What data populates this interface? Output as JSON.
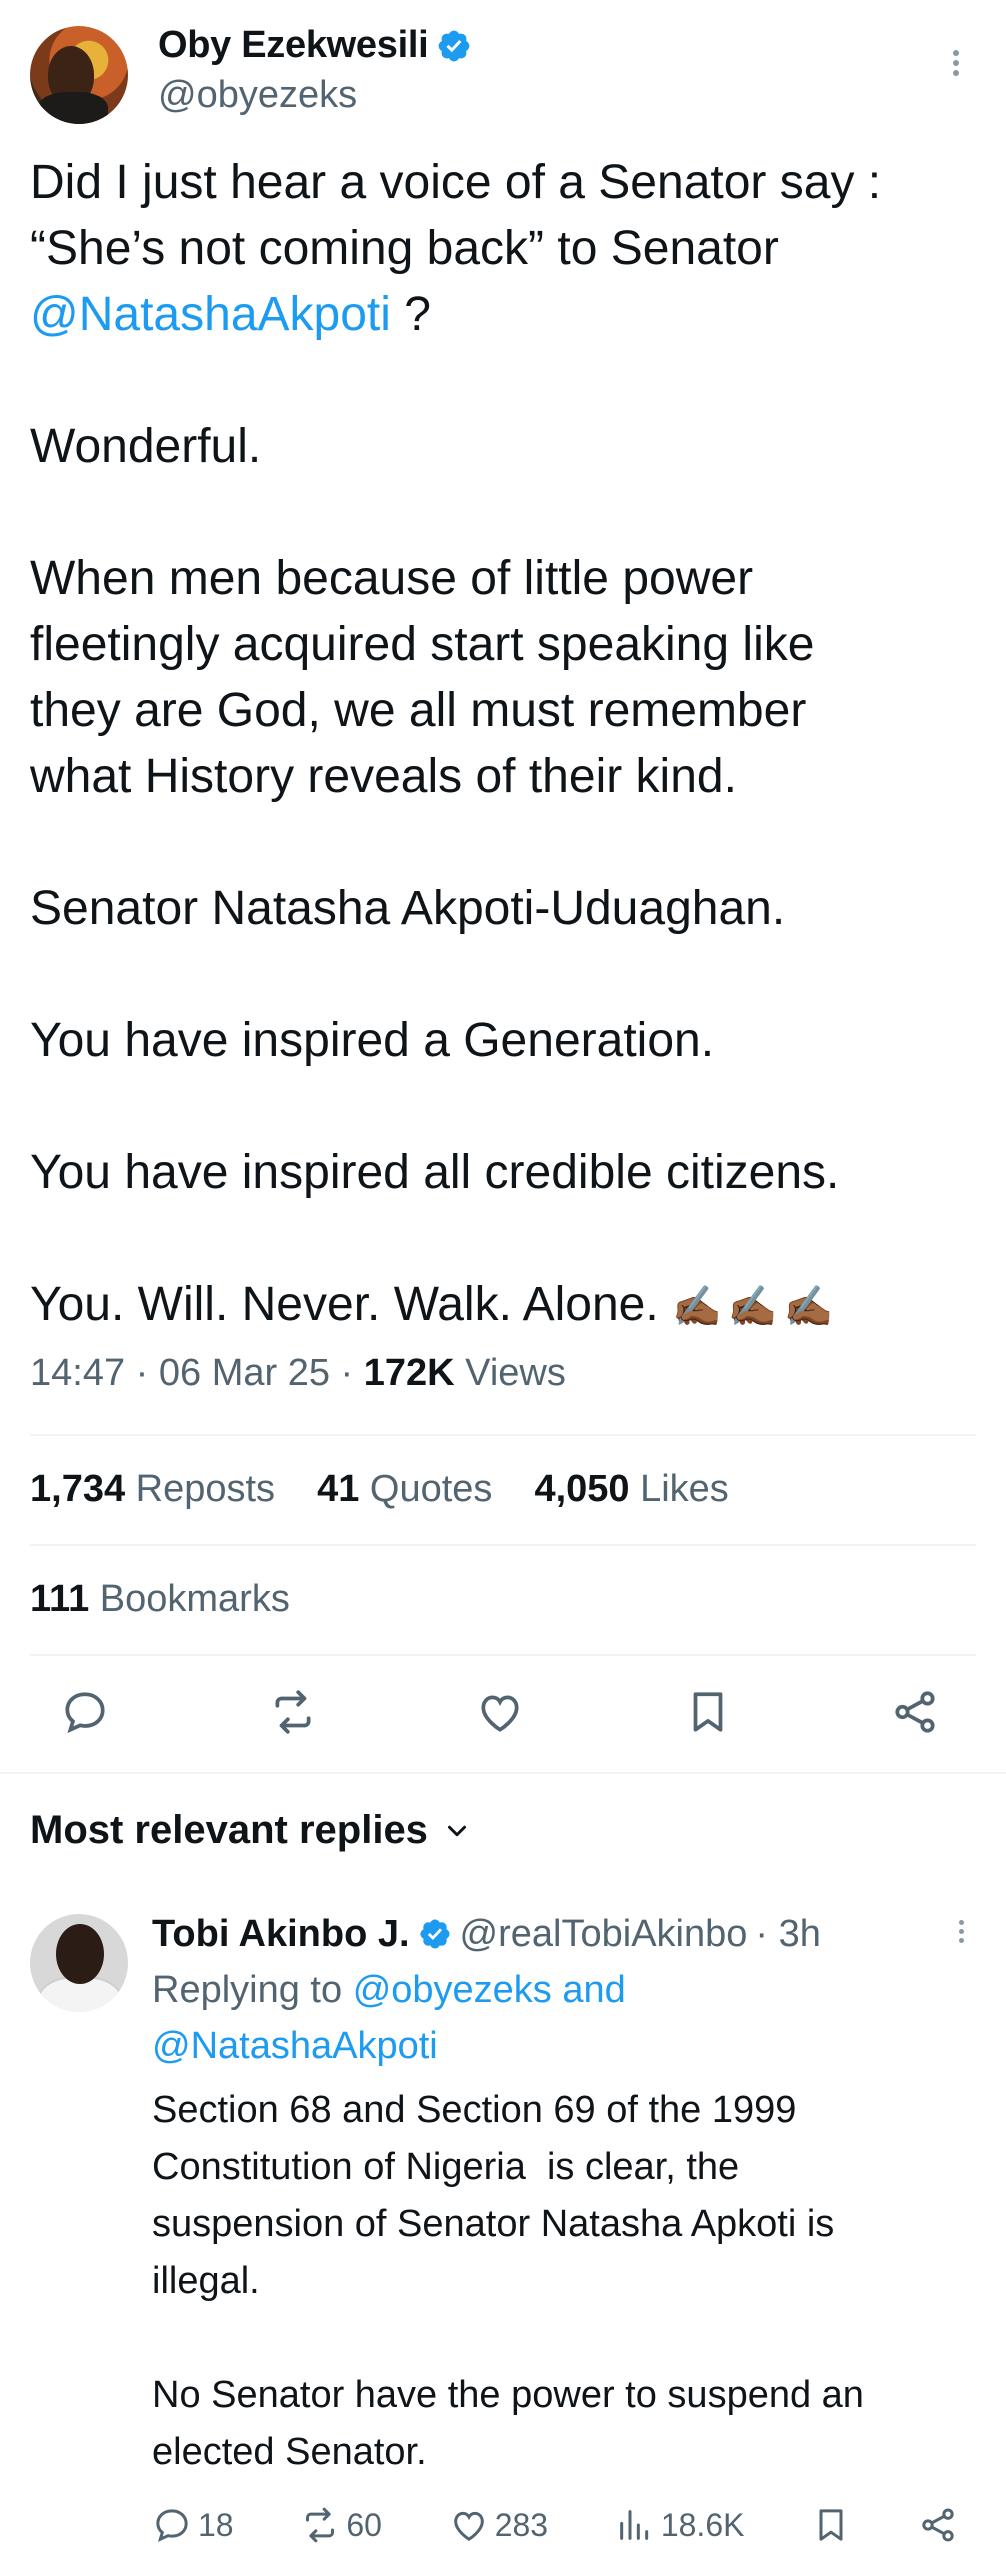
{
  "tweet": {
    "author_name": "Oby Ezekwesili",
    "author_handle": "@obyezeks",
    "line1": "Did I just hear a voice of a Senator say :",
    "line2": "“She’s not coming back” to Senator",
    "mention": "@NatashaAkpoti",
    "line3_suffix": " ?",
    "para_wonderful": "Wonderful.",
    "para_men": "When men because of little power fleetingly acquired start speaking like they are God, we all must remember what History reveals of their kind.",
    "para_senator": "Senator Natasha Akpoti-Uduaghan.",
    "para_generation": "You have inspired a Generation.",
    "para_citizens": "You have inspired all credible citizens.",
    "para_alone": "You. Will. Never. Walk. Alone.",
    "emoji": "✍🏾✍🏾✍🏾",
    "time": "14:47",
    "date": "06 Mar 25",
    "views_count": "172K",
    "views_label": "Views",
    "reposts_count": "1,734",
    "reposts_label": "Reposts",
    "quotes_count": "41",
    "quotes_label": "Quotes",
    "likes_count": "4,050",
    "likes_label": "Likes",
    "bookmarks_count": "111",
    "bookmarks_label": "Bookmarks"
  },
  "replies_section": {
    "title": "Most relevant replies"
  },
  "reply": {
    "author_name": "Tobi Akinbo J.",
    "author_handle": "@realTobiAkinbo",
    "time": "· 3h",
    "replying_prefix": "Replying to",
    "replying_to_1": "@obyezeks and",
    "replying_to_2": "@NatashaAkpoti",
    "text_1": "Section 68 and Section 69 of the 1999 Constitution of Nigeria  is clear, the suspension of Senator Natasha Apkoti is illegal.",
    "text_2": "No Senator have the power to suspend an elected Senator.",
    "reply_count": "18",
    "repost_count": "60",
    "like_count": "283",
    "views_count": "18.6K"
  },
  "colors": {
    "accent": "#1d9bf0",
    "text": "#0f1419",
    "secondary": "#536471"
  }
}
